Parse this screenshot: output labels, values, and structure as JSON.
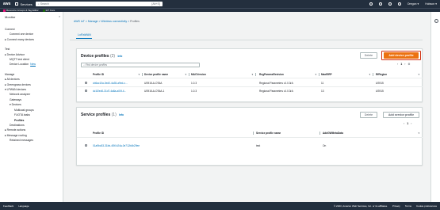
{
  "topbar": {
    "logo": "aws",
    "services": "Services",
    "search_placeholder": "Search",
    "search_shortcut": "[Alt+S]",
    "region": "Oregon ▾",
    "account": "Hobson ▾"
  },
  "favorites": {
    "items": [
      {
        "label": "Resource Groups & Tag Editor",
        "color": "#e7157b"
      },
      {
        "label": "IoT Core",
        "color": "#1b660f"
      }
    ]
  },
  "sidebar": {
    "title": "Monitor",
    "items": [
      {
        "label": "Connect",
        "level": 0
      },
      {
        "label": "Connect one device",
        "level": 1
      },
      {
        "label": "▸ Connect many devices",
        "level": 0
      },
      {
        "gap": true
      },
      {
        "label": "Test",
        "level": 0
      },
      {
        "label": "▸ Device Advisor",
        "level": 0
      },
      {
        "label": "MQTT test client",
        "level": 1
      },
      {
        "label": "Device Location",
        "level": 1,
        "badge": "New"
      },
      {
        "gap": true
      },
      {
        "label": "Manage",
        "level": 0
      },
      {
        "label": "▸ All devices",
        "level": 0
      },
      {
        "label": "▸ Greengrass devices",
        "level": 0
      },
      {
        "label": "▾ LPWAN devices",
        "level": 0
      },
      {
        "label": "Network analyzer",
        "level": 1
      },
      {
        "label": "Gateways",
        "level": 1
      },
      {
        "label": "▾ Devices",
        "level": 1
      },
      {
        "label": "Multicast groups",
        "level": 2
      },
      {
        "label": "FUOTA tasks",
        "level": 2
      },
      {
        "label": "Profiles",
        "level": 2,
        "active": true
      },
      {
        "label": "Destinations",
        "level": 1
      },
      {
        "label": "▸ Remote actions",
        "level": 0
      },
      {
        "label": "▸ Message routing",
        "level": 0
      },
      {
        "label": "Retained messages",
        "level": 1
      }
    ]
  },
  "breadcrumb": {
    "items": [
      "AWS IoT",
      "Manage",
      "Wireless connectivity"
    ],
    "current": "Profiles"
  },
  "tab": "LoRaWAN",
  "device_profiles": {
    "title": "Device profiles",
    "count": "(2)",
    "info": "Info",
    "delete_label": "Delete",
    "add_label": "Add device profile",
    "filter_placeholder": "Find device profiles",
    "page": "1",
    "columns": [
      "Profile ID",
      "Device profile name",
      "MACVersion",
      "RegParamsRevision",
      "MaxEIRP",
      "RfRegion"
    ],
    "rows": [
      [
        "cb6ac10a-0ed0-4a35-a9ed-c...",
        "US915-A-OTAA",
        "1.0.3",
        "Regional Parameters v1.0.3rA",
        "11",
        "US915"
      ],
      [
        "dc1f2ed0-31d7-4a8a-a00f-4...",
        "US915-A-OTAA-1",
        "1.0.3",
        "Regional Parameters v1.0.3rA",
        "13",
        "US915"
      ]
    ]
  },
  "service_profiles": {
    "title": "Service profiles",
    "count": "(1)",
    "info": "Info",
    "delete_label": "Delete",
    "add_label": "Add service profile",
    "page": "1",
    "columns": [
      "Profile ID",
      "Service profile name",
      "AddGWMetaData"
    ],
    "rows": [
      [
        "01a9bc53-31bb-4f0f-b24a-0e712b4b29ee",
        "test",
        "On"
      ]
    ]
  },
  "footer": {
    "left": [
      "Feedback",
      "Language"
    ],
    "right": [
      "© 2023, Amazon Web Services, Inc. or its affiliates.",
      "Privacy",
      "Terms",
      "Cookie preferences"
    ]
  }
}
